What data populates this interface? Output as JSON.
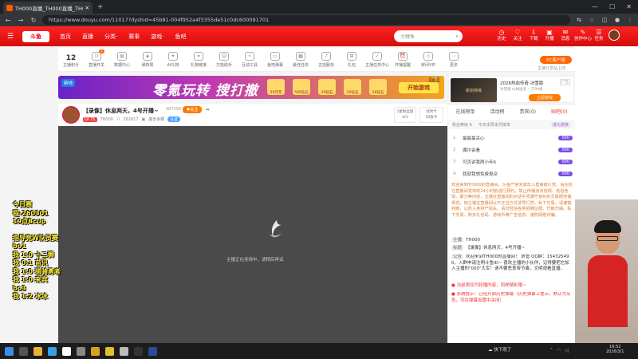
{
  "browser": {
    "tab_title": "TH000直播_TH000直播_TH000视",
    "new_tab": "+",
    "url": "https://www.douyu.com/11017?dyshid=45b81-004f952a4f3355de51c0dc600091701"
  },
  "header": {
    "logo": "斗鱼",
    "nav": [
      "首页",
      "直播",
      "分类·",
      "赛事",
      "游戏·",
      "鱼吧"
    ],
    "search_placeholder": "大鲤鱼",
    "icons": [
      {
        "label": "历史",
        "glyph": "◷"
      },
      {
        "label": "关注",
        "glyph": "♡"
      },
      {
        "label": "下载",
        "glyph": "⇩"
      },
      {
        "label": "开播",
        "glyph": "▣"
      },
      {
        "label": "消息",
        "glyph": "✉"
      },
      {
        "label": "创作中心",
        "glyph": "✎"
      },
      {
        "label": "任务",
        "glyph": "☰"
      }
    ]
  },
  "toolbar": {
    "level": "12",
    "level_label": "主播积分",
    "items": [
      {
        "label": "直播开关",
        "badge": "1"
      },
      {
        "label": "数据中心",
        "badge": ""
      },
      {
        "label": "弹药局",
        "badge": ""
      },
      {
        "label": "AI礼物",
        "badge": ""
      },
      {
        "label": "礼物链接",
        "badge": ""
      },
      {
        "label": "万能助手",
        "badge": ""
      },
      {
        "label": "互动工具",
        "badge": ""
      },
      {
        "label": "鱼吧弹幕",
        "badge": ""
      },
      {
        "label": "最佳任务",
        "badge": ""
      },
      {
        "label": "正拍服务",
        "badge": ""
      },
      {
        "label": "礼包",
        "badge": ""
      },
      {
        "label": "主播任务中心",
        "badge": ""
      },
      {
        "label": "开播提醒",
        "badge": ""
      },
      {
        "label": "房间VIP",
        "badge": ""
      },
      {
        "label": "更多",
        "badge": ""
      }
    ],
    "pc_button": "PC客户端",
    "pc_sub": "主播分享站上线"
  },
  "banner": {
    "tag": "新地",
    "headline": "零氪玩转 搜打撤",
    "rewards": [
      "29元无",
      "500钻石",
      "29钻石",
      "20钻石",
      "28钻石"
    ],
    "cta": "开始游戏",
    "ad": "广告"
  },
  "banner2": {
    "img_text": "新剑侠缘",
    "title": "2026热血传奇·冰雪版",
    "subtitle": "冰雪版 山林送道 一刀99级",
    "button": "立即游戏",
    "ad": "广告"
  },
  "stream": {
    "title": "【录像】休息两天，4号开播~",
    "views": "487293",
    "follow": "关注",
    "level": "LV 71",
    "name": "TH000",
    "room_id": "262617",
    "category": "魔兽争霸",
    "tag": "认证",
    "fans_label": "1星粉丝团",
    "fans_value": "0/3",
    "cards_label": "试听卡",
    "cards_value": "20张卡"
  },
  "player": {
    "loading": "主播正在连线中，请稍后再试"
  },
  "side": {
    "tabs": [
      "在线榜单",
      "活动榜",
      "贵宾(0)",
      "贴吧(0)"
    ],
    "active_tab": 3,
    "rank_label": "粉丝等级 6",
    "rank_hint": "今天本周本月榜单",
    "rank_grade": "成为贵族",
    "ranks": [
      {
        "n": "1",
        "name": "最最最关心",
        "value": "000"
      },
      {
        "n": "2",
        "name": "偶尔会看",
        "value": "000"
      },
      {
        "n": "3",
        "name": "可否讲我两小年6",
        "value": "000"
      },
      {
        "n": "4",
        "name": "我就我想免费观众",
        "value": "000"
      }
    ],
    "notice": "欢迎来到TH000的直播间。斗鱼严禁未成年人直播或打赏。请在前往直播间发布的24小时前进行预约，禁止传播违法违规、低俗色情、暴力等内容，主播在直播间的对话中须遵守良好的互联网传播规范，如主播在直播间以不正当方式诱导打赏，私下交易，请谨慎判断，以防人身财产损失。请勿轻信各类招聘征婚、代练代抽、私下交易、购买礼包码、游戏币等广告信息，谨防网络诈骗。",
    "messages": [
      {
        "label": "主播",
        "text": "TH000",
        "color": ""
      },
      {
        "label": "标题",
        "text": "【录像】休息两天，4号开播~",
        "color": ""
      },
      {
        "label": "公告",
        "text": "欢迎来到TH000的直播间！ 房管 QQ群：15432549 0，入群申请注明斗鱼ID~ 喜欢主播的小伙伴，记得要把它加入主播的\"000\"大军！请不要恶意带节奏，文明观看直播。",
        "color": ""
      },
      {
        "label": "",
        "text": "当前房间为轮播内容，同样精彩哦~",
        "color": "red"
      },
      {
        "label": "",
        "text": "系统提示：已经开启历史弹幕（历史弹幕上提示，默认为灰色，可在弹幕设置中关闭）",
        "color": "red"
      }
    ]
  },
  "overlay": {
    "lines": [
      "今日赛程-260301",
      "19点Bcup",
      "",
      "指导竞W队员赛",
      "bo1",
      "我 1:0 十二狮",
      "我 0:1 苗讯",
      "我 1:0 猎骑勇者",
      "我 1:0 来宾",
      "bo3",
      "我 1:2 冰冰"
    ]
  },
  "cam": {
    "logo": "斗鱼"
  },
  "taskbar": {
    "weather": "快下雨了",
    "time": "16:52",
    "date": "2026/3/1"
  }
}
